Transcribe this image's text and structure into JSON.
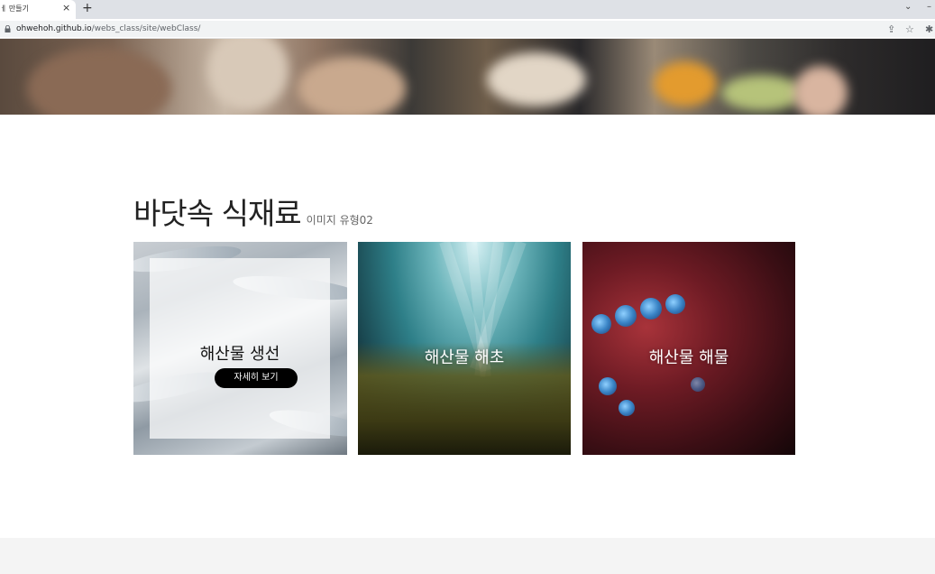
{
  "browser": {
    "tab_title": "ㅔ 만들기",
    "tab_close": "×",
    "new_tab": "+",
    "url_host": "ohwehoh.github.io",
    "url_path": "/webs_class/site/webClass/",
    "icons": [
      "lock-icon",
      "share-icon",
      "star-icon",
      "extensions-icon",
      "chevron-down-icon"
    ]
  },
  "section": {
    "title": "바닷속 식재료",
    "subtitle": "이미지 유형02"
  },
  "cards": [
    {
      "label": "해산물 생선",
      "button": "자세히 보기"
    },
    {
      "label": "해산물 해초"
    },
    {
      "label": "해산물 해물"
    }
  ]
}
